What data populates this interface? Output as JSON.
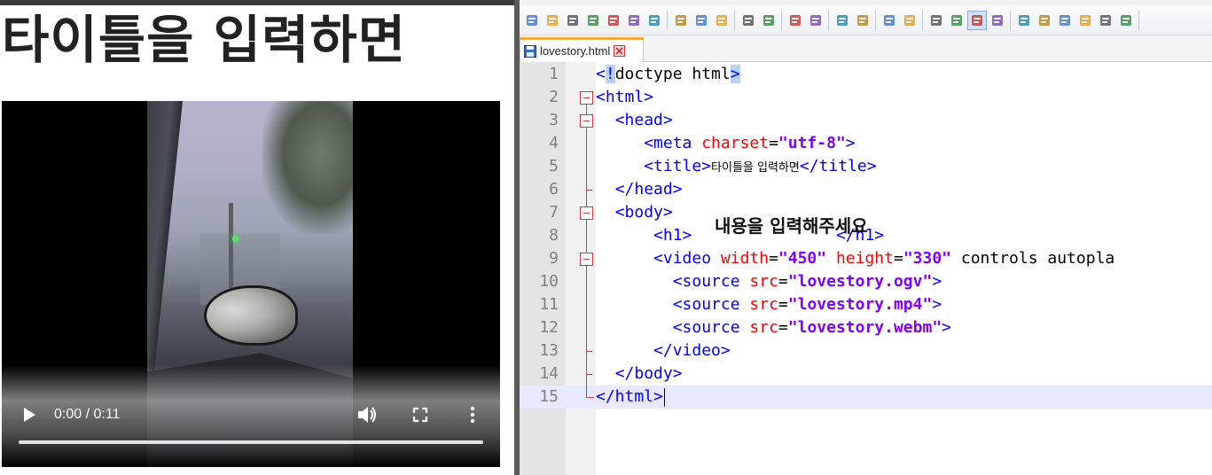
{
  "browser": {
    "page_heading": "타이틀을 입력하면",
    "video": {
      "time_display": "0:00 / 0:11",
      "progress_fraction": 0.0
    }
  },
  "editor": {
    "tab": {
      "file_name": "lovestory.html"
    },
    "toolbar_icons": [
      "new-file-icon",
      "open-file-icon",
      "save-icon",
      "save-all-icon",
      "close-icon",
      "close-all-icon",
      "print-icon",
      "cut-icon",
      "copy-icon",
      "paste-icon",
      "undo-icon",
      "redo-icon",
      "find-icon",
      "replace-icon",
      "zoom-in-icon",
      "zoom-out-icon",
      "sync-vertical-icon",
      "sync-horizontal-icon",
      "word-wrap-icon",
      "show-all-chars-icon",
      "indent-guide-icon",
      "language-icon",
      "doc-map-icon",
      "function-list-icon",
      "folder-workspace-icon",
      "monitor-icon",
      "macro-icon",
      "view-icon"
    ],
    "code_lines": [
      {
        "n": "1",
        "segments": [
          {
            "c": "tag",
            "t": "<"
          },
          {
            "c": "tag-hl",
            "t": "!"
          },
          {
            "c": "plain",
            "t": "doctype html"
          },
          {
            "c": "tag-hl",
            "t": ">"
          }
        ]
      },
      {
        "n": "2",
        "segments": [
          {
            "c": "tag",
            "t": "<html>"
          }
        ]
      },
      {
        "n": "3",
        "segments": [
          {
            "c": "plain",
            "t": "  "
          },
          {
            "c": "tag",
            "t": "<head>"
          }
        ]
      },
      {
        "n": "4",
        "segments": [
          {
            "c": "plain",
            "t": "     "
          },
          {
            "c": "tag",
            "t": "<meta "
          },
          {
            "c": "attr",
            "t": "charset"
          },
          {
            "c": "plain",
            "t": "="
          },
          {
            "c": "val",
            "t": "\"utf-8\""
          },
          {
            "c": "tag",
            "t": ">"
          }
        ]
      },
      {
        "n": "5",
        "segments": [
          {
            "c": "plain",
            "t": "     "
          },
          {
            "c": "tag",
            "t": "<title>"
          },
          {
            "c": "kor",
            "t": "타이틀을 입력하면"
          },
          {
            "c": "tag",
            "t": "</title>"
          }
        ]
      },
      {
        "n": "6",
        "segments": [
          {
            "c": "plain",
            "t": "  "
          },
          {
            "c": "tag",
            "t": "</head>"
          }
        ]
      },
      {
        "n": "7",
        "segments": [
          {
            "c": "plain",
            "t": "  "
          },
          {
            "c": "tag",
            "t": "<body>"
          }
        ]
      },
      {
        "n": "8",
        "segments": [
          {
            "c": "plain",
            "t": "      "
          },
          {
            "c": "tag",
            "t": "<h1>"
          },
          {
            "c": "plain",
            "t": "               "
          },
          {
            "c": "tag",
            "t": "</h1>"
          }
        ]
      },
      {
        "n": "9",
        "segments": [
          {
            "c": "plain",
            "t": "      "
          },
          {
            "c": "tag",
            "t": "<video "
          },
          {
            "c": "attr",
            "t": "width"
          },
          {
            "c": "plain",
            "t": "="
          },
          {
            "c": "val",
            "t": "\"450\""
          },
          {
            "c": "plain",
            "t": " "
          },
          {
            "c": "attr",
            "t": "height"
          },
          {
            "c": "plain",
            "t": "="
          },
          {
            "c": "val",
            "t": "\"330\""
          },
          {
            "c": "plain",
            "t": " controls autopla"
          }
        ]
      },
      {
        "n": "10",
        "segments": [
          {
            "c": "plain",
            "t": "        "
          },
          {
            "c": "tag",
            "t": "<source "
          },
          {
            "c": "attr",
            "t": "src"
          },
          {
            "c": "plain",
            "t": "="
          },
          {
            "c": "val",
            "t": "\"lovestory.ogv\""
          },
          {
            "c": "tag",
            "t": ">"
          }
        ]
      },
      {
        "n": "11",
        "segments": [
          {
            "c": "plain",
            "t": "        "
          },
          {
            "c": "tag",
            "t": "<source "
          },
          {
            "c": "attr",
            "t": "src"
          },
          {
            "c": "plain",
            "t": "="
          },
          {
            "c": "val",
            "t": "\"lovestory.mp4\""
          },
          {
            "c": "tag",
            "t": ">"
          }
        ]
      },
      {
        "n": "12",
        "segments": [
          {
            "c": "plain",
            "t": "        "
          },
          {
            "c": "tag",
            "t": "<source "
          },
          {
            "c": "attr",
            "t": "src"
          },
          {
            "c": "plain",
            "t": "="
          },
          {
            "c": "val",
            "t": "\"lovestory.webm\""
          },
          {
            "c": "tag",
            "t": ">"
          }
        ]
      },
      {
        "n": "13",
        "segments": [
          {
            "c": "plain",
            "t": "      "
          },
          {
            "c": "tag",
            "t": "</video>"
          }
        ]
      },
      {
        "n": "14",
        "segments": [
          {
            "c": "plain",
            "t": "  "
          },
          {
            "c": "tag",
            "t": "</body>"
          }
        ]
      },
      {
        "n": "15",
        "segments": [
          {
            "c": "tag",
            "t": "</html>"
          }
        ]
      }
    ],
    "h1_content_overlay": "내용을 입력해주세요"
  }
}
